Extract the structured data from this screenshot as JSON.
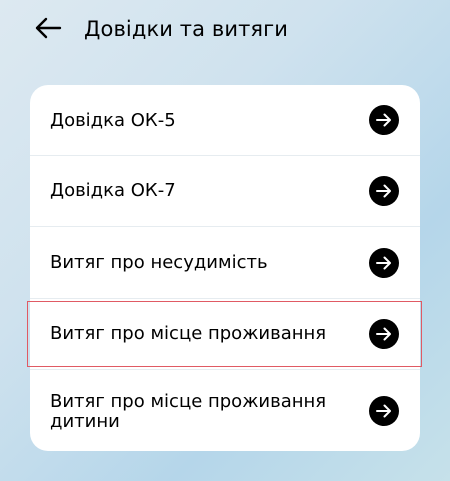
{
  "header": {
    "back_icon": "arrow-left-icon",
    "title": "Довідки та витяги"
  },
  "list": {
    "items": [
      {
        "label": "Довідка ОК-5",
        "icon": "arrow-right-circle-icon"
      },
      {
        "label": "Довідка ОК-7",
        "icon": "arrow-right-circle-icon"
      },
      {
        "label": "Витяг про несудимість",
        "icon": "arrow-right-circle-icon"
      },
      {
        "label": "Витяг про місце проживання",
        "icon": "arrow-right-circle-icon"
      },
      {
        "label": "Витяг про місце проживання дитини",
        "icon": "arrow-right-circle-icon"
      }
    ],
    "selected_item": "Витяг про місце проживання"
  },
  "colors": {
    "card_background": "#ffffff",
    "arrow_button": "#000000",
    "highlight_border": "#e05a64",
    "divider": "#e6ecf0"
  }
}
